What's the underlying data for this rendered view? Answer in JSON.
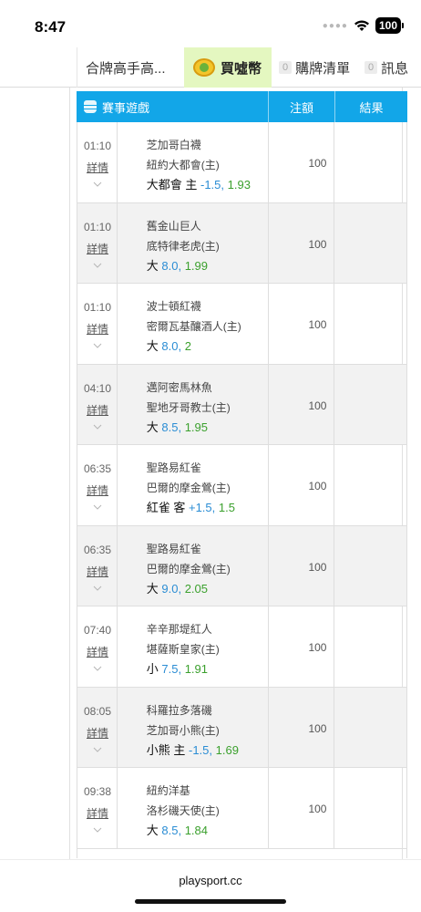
{
  "status_bar": {
    "time": "8:47",
    "battery": "100"
  },
  "tabs": [
    {
      "label": "合牌高手高..."
    },
    {
      "label": "買噓幣"
    },
    {
      "count": "0",
      "label": "購牌清單"
    },
    {
      "count": "0",
      "label": "訊息"
    }
  ],
  "table": {
    "headers": {
      "game": "賽事遊戲",
      "stake": "注額",
      "result": "結果"
    },
    "rows": [
      {
        "time": "01:10",
        "details": "詳情",
        "away": "芝加哥白襪",
        "home": "紐約大都會(主)",
        "pick": "大都會 主",
        "line": "-1.5",
        "odds": "1.93",
        "stake": "100",
        "result": ""
      },
      {
        "time": "01:10",
        "details": "詳情",
        "away": "舊金山巨人",
        "home": "底特律老虎(主)",
        "pick": "大",
        "line": "8.0",
        "odds": "1.99",
        "stake": "100",
        "result": ""
      },
      {
        "time": "01:10",
        "details": "詳情",
        "away": "波士頓紅襪",
        "home": "密爾瓦基釀酒人(主)",
        "pick": "大",
        "line": "8.0",
        "odds": "2",
        "stake": "100",
        "result": ""
      },
      {
        "time": "04:10",
        "details": "詳情",
        "away": "邁阿密馬林魚",
        "home": "聖地牙哥教士(主)",
        "pick": "大",
        "line": "8.5",
        "odds": "1.95",
        "stake": "100",
        "result": ""
      },
      {
        "time": "06:35",
        "details": "詳情",
        "away": "聖路易紅雀",
        "home": "巴爾的摩金鶯(主)",
        "pick": "紅雀 客",
        "line": "+1.5",
        "odds": "1.5",
        "stake": "100",
        "result": ""
      },
      {
        "time": "06:35",
        "details": "詳情",
        "away": "聖路易紅雀",
        "home": "巴爾的摩金鶯(主)",
        "pick": "大",
        "line": "9.0",
        "odds": "2.05",
        "stake": "100",
        "result": ""
      },
      {
        "time": "07:40",
        "details": "詳情",
        "away": "辛辛那堤紅人",
        "home": "堪薩斯皇家(主)",
        "pick": "小",
        "line": "7.5",
        "odds": "1.91",
        "stake": "100",
        "result": ""
      },
      {
        "time": "08:05",
        "details": "詳情",
        "away": "科羅拉多落磯",
        "home": "芝加哥小熊(主)",
        "pick": "小熊 主",
        "line": "-1.5",
        "odds": "1.69",
        "stake": "100",
        "result": ""
      },
      {
        "time": "09:38",
        "details": "詳情",
        "away": "紐約洋基",
        "home": "洛杉磯天使(主)",
        "pick": "大",
        "line": "8.5",
        "odds": "1.84",
        "stake": "100",
        "result": ""
      }
    ]
  },
  "browser": {
    "url": "playsport.cc"
  },
  "colors": {
    "header_blue": "#12a6e8",
    "active_tab": "#e4f7c0",
    "line_blue": "#2b8dd4",
    "odds_green": "#3ba02d"
  }
}
